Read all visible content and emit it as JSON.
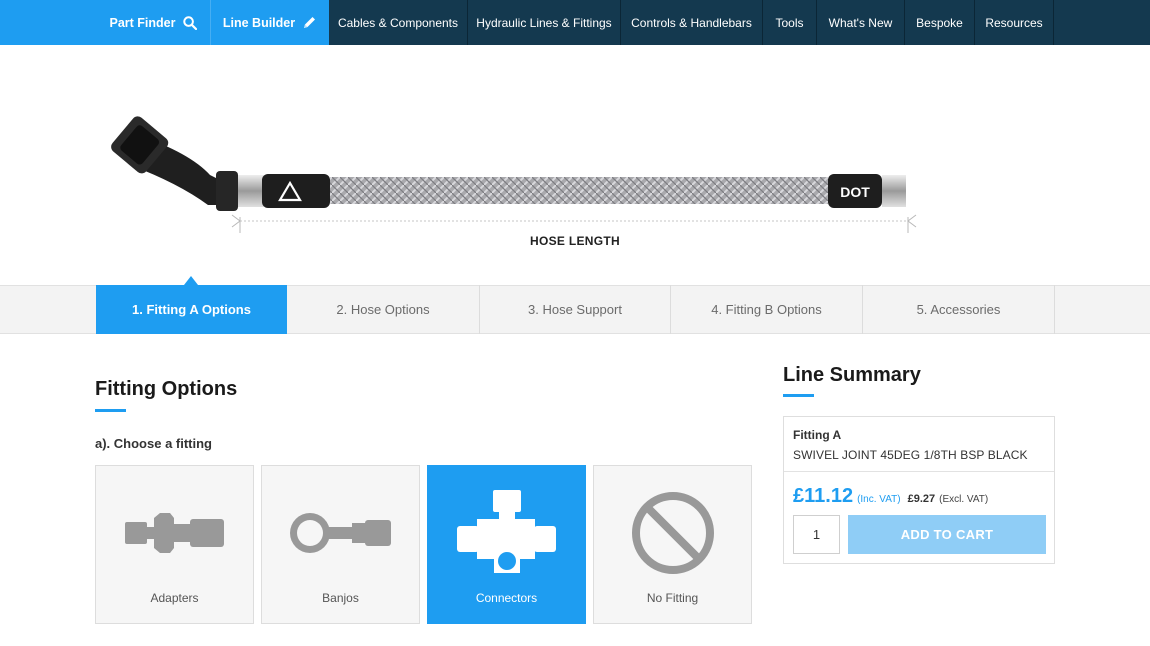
{
  "nav": {
    "part_finder": "Part Finder",
    "line_builder": "Line Builder",
    "items": [
      {
        "label": "Cables & Components"
      },
      {
        "label": "Hydraulic Lines & Fittings"
      },
      {
        "label": "Controls & Handlebars"
      },
      {
        "label": "Tools"
      },
      {
        "label": "What's New"
      },
      {
        "label": "Bespoke"
      },
      {
        "label": "Resources"
      }
    ]
  },
  "hero": {
    "dot_label": "DOT",
    "hose_length_label": "HOSE LENGTH"
  },
  "steps": [
    {
      "label": "1. Fitting A Options",
      "active": true
    },
    {
      "label": "2. Hose Options",
      "active": false
    },
    {
      "label": "3. Hose Support",
      "active": false
    },
    {
      "label": "4. Fitting B Options",
      "active": false
    },
    {
      "label": "5. Accessories",
      "active": false
    }
  ],
  "fitting_options": {
    "title": "Fitting Options",
    "sub_label": "a). Choose a fitting",
    "options": [
      {
        "label": "Adapters",
        "icon": "adapter-icon",
        "active": false
      },
      {
        "label": "Banjos",
        "icon": "banjo-icon",
        "active": false
      },
      {
        "label": "Connectors",
        "icon": "connector-icon",
        "active": true
      },
      {
        "label": "No Fitting",
        "icon": "no-fitting-icon",
        "active": false
      }
    ]
  },
  "summary": {
    "title": "Line Summary",
    "fitting_label": "Fitting A",
    "fitting_value": "SWIVEL JOINT 45DEG 1/8TH BSP BLACK",
    "price_inc": "£11.12",
    "price_inc_label": "(Inc. VAT)",
    "price_ex": "£9.27",
    "price_ex_label": "(Excl. VAT)",
    "quantity": "1",
    "add_to_cart": "ADD TO CART"
  },
  "colors": {
    "accent": "#1e9df1",
    "nav_dark": "#14394f",
    "button_disabled": "#8fcdf6"
  }
}
